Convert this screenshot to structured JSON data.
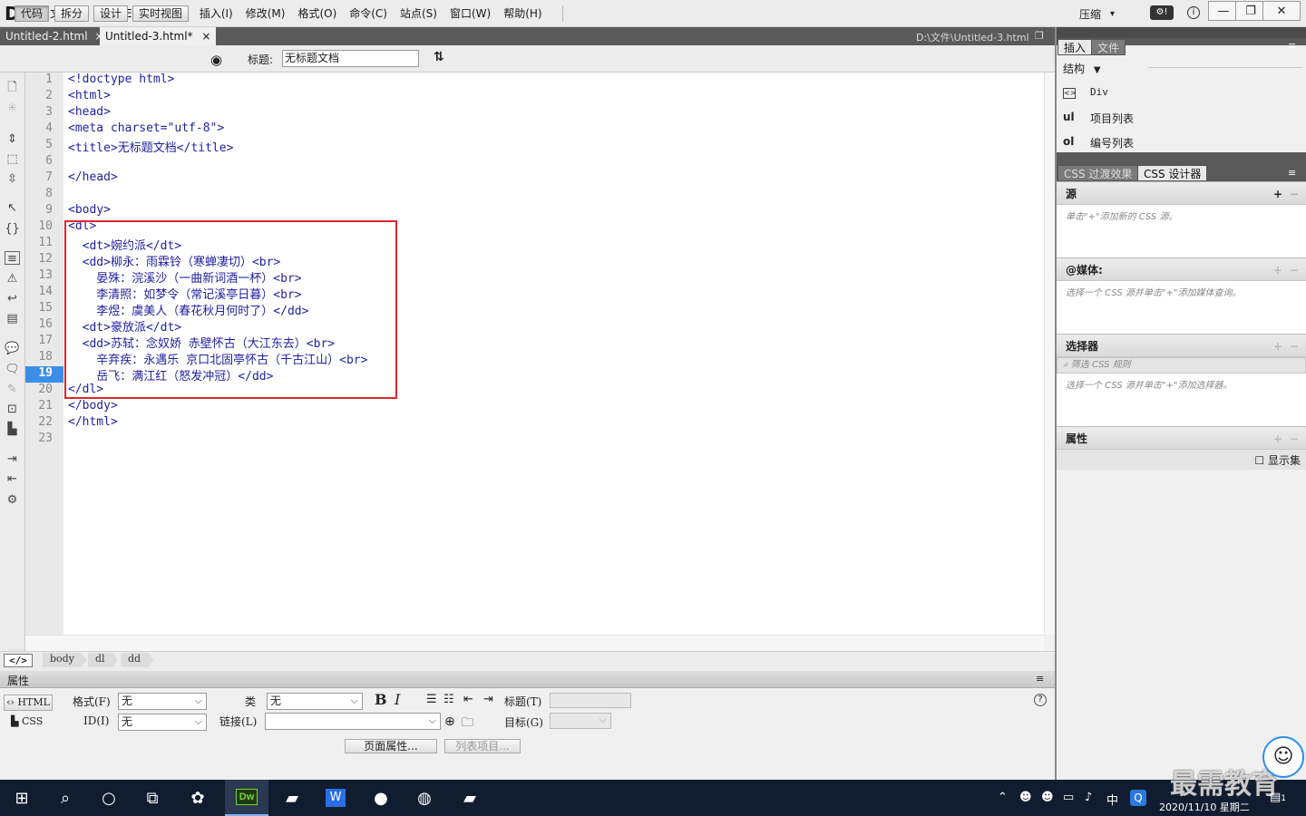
{
  "app": {
    "logo": "Dw",
    "menus": [
      "文件(F)",
      "编辑(E)",
      "查看(V)",
      "插入(I)",
      "修改(M)",
      "格式(O)",
      "命令(C)",
      "站点(S)",
      "窗口(W)",
      "帮助(H)"
    ],
    "compress": "压缩",
    "compress_arrow": "▾"
  },
  "doc_tabs": [
    {
      "label": "Untitled-2.html",
      "close": "×"
    },
    {
      "label": "Untitled-3.html*",
      "close": "×"
    }
  ],
  "doc_path": "D:\\文件\\Untitled-3.html",
  "toolbar": {
    "views": [
      "代码",
      "拆分",
      "设计",
      "实时视图"
    ],
    "title_label": "标题:",
    "title_value": "无标题文档"
  },
  "gutter": {
    "lines": [
      "1",
      "2",
      "3",
      "4",
      "5",
      "6",
      "7",
      "8",
      "9",
      "10",
      "11",
      "12",
      "13",
      "14",
      "15",
      "16",
      "17",
      "18",
      "19",
      "20",
      "21",
      "22",
      "23"
    ],
    "current": "19"
  },
  "code": [
    "<!doctype html>",
    "<html>",
    "<head>",
    "<meta charset=\"utf-8\">",
    "<title>无标题文档</title>",
    "",
    "</head>",
    "",
    "<body>",
    "<dl>",
    "  <dt>婉约派</dt>",
    "  <dd>柳永：雨霖铃（寒蝉凄切）<br>",
    "    晏殊：浣溪沙（一曲新词酒一杯）<br>",
    "    李清照：如梦令（常记溪亭日暮）<br>",
    "    李煜：虞美人（春花秋月何时了）</dd>",
    "  <dt>豪放派</dt>",
    "  <dd>苏轼：念奴娇 赤壁怀古（大江东去）<br>",
    "    辛弃疾：永遇乐 京口北固亭怀古（千古江山）<br>",
    "    岳飞：满江红（怒发冲冠）</dd>",
    "</dl>",
    "</body>",
    "</html>",
    ""
  ],
  "tag_selector": {
    "code_icon": "</>",
    "crumbs": [
      "body",
      "dl",
      "dd"
    ]
  },
  "properties": {
    "title": "属性",
    "html_btn": "HTML",
    "css_btn": "CSS",
    "format_label": "格式(F)",
    "format_value": "无",
    "id_label": "ID(I)",
    "id_value": "无",
    "class_label": "类",
    "class_value": "无",
    "bold": "B",
    "italic": "I",
    "link_label": "链接(L)",
    "heading_label": "标题(T)",
    "target_label": "目标(G)",
    "page_props": "页面属性...",
    "list_item": "列表项目..."
  },
  "right_panel": {
    "tabs": [
      "插入",
      "文件"
    ],
    "structure_label": "结构",
    "items": [
      {
        "abbr": "<>",
        "label": "Div"
      },
      {
        "abbr": "ul",
        "label": "项目列表"
      },
      {
        "abbr": "ol",
        "label": "编号列表"
      }
    ],
    "css_tabs": [
      "CSS 过渡效果",
      "CSS 设计器"
    ],
    "sources_title": "源",
    "sources_hint": "单击\"+\"添加新的 CSS 源。",
    "media_title": "@媒体:",
    "media_hint": "选择一个 CSS 源并单击\"+\"添加媒体查询。",
    "selectors_title": "选择器",
    "selectors_filter": "筛选 CSS 规则",
    "selectors_hint": "选择一个 CSS 源并单击\"+\"添加选择器。",
    "props_title": "属性",
    "show_set": "显示集",
    "plus": "+",
    "minus": "−"
  },
  "taskbar": {
    "time": "2020/11/10 星期二",
    "ime": "中",
    "watermark": "最需教育",
    "notif_count": "1"
  }
}
